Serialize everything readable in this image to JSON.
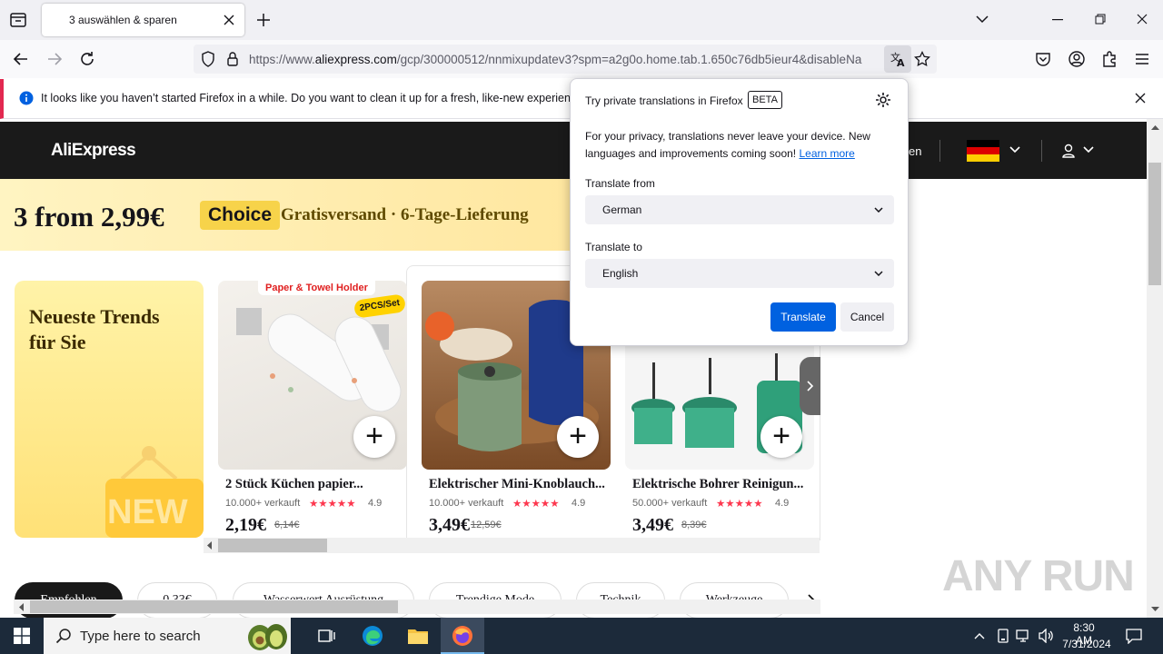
{
  "browser": {
    "tab_title": "3 auswählen & sparen",
    "url_prefix": "https://www.",
    "url_domain": "aliexpress.com",
    "url_rest": "/gcp/300000512/nnmixupdatev3?spm=a2g0o.home.tab.1.650c76db5ieur4&disableNa",
    "notification": "It looks like you haven’t started Firefox in a while. Do you want to clean it up for a fresh, like-new experience? A"
  },
  "translate_panel": {
    "title": "Try private translations in Firefox",
    "badge": "BETA",
    "description": "For your privacy, translations never leave your device. New languages and improvements coming soon!",
    "learn_more": "Learn more",
    "from_label": "Translate from",
    "from_value": "German",
    "to_label": "Translate to",
    "to_value": "English",
    "translate_button": "Translate",
    "cancel_button": "Cancel"
  },
  "page": {
    "logo": "AliExpress",
    "header_partial_text": "en",
    "promo_price": "3 from 2,99€",
    "promo_choice": "Choice",
    "promo_shipping": "Gratisversand · 6-Tage-Lieferung",
    "trend_title": "Neueste Trends für Sie",
    "trend_badge": "NEW",
    "products": [
      {
        "banner": "Paper & Towel Holder",
        "badge": "2PCS/Set",
        "name": "2 Stück Küchen papier...",
        "sold": "10.000+ verkauft",
        "rating": "4.9",
        "price": "2,19€",
        "old_price": "6,14€"
      },
      {
        "name": "Elektrischer Mini-Knoblauch...",
        "sold": "10.000+ verkauft",
        "rating": "4.9",
        "price": "3,49€",
        "old_price": "12,59€"
      },
      {
        "name": "Elektrische Bohrer Reinigun...",
        "sold": "50.000+ verkauft",
        "rating": "4.9",
        "price": "3,49€",
        "old_price": "8,39€"
      }
    ],
    "stars": "★★★★★",
    "chips": [
      "Empfohlen",
      "0,33€",
      "Wasserwert Ausrüstung",
      "Trendige Mode",
      "Technik",
      "Werkzeuge"
    ]
  },
  "taskbar": {
    "search_placeholder": "Type here to search",
    "time": "8:30 AM",
    "date": "7/31/2024"
  },
  "watermark": "ANY RUN",
  "colors": {
    "accent": "#0061e0",
    "ali_header": "#1a1a1a",
    "promo_yellow": "#fff4c2",
    "choice": "#f7d34a"
  }
}
